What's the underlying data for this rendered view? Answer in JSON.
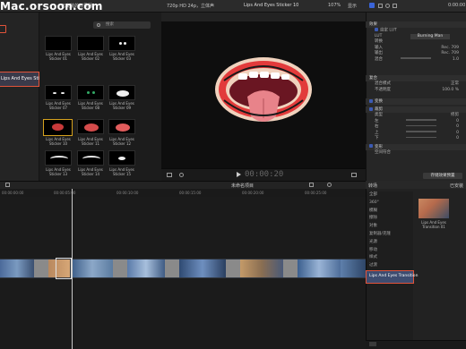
{
  "watermark": "Mac.orsoon.com",
  "topbar": {
    "library_title": "已安装的效果器",
    "format_label": "720p HD 24p，立体声",
    "clip_title": "Lips And Eyes Sticker 10",
    "zoom": "107%",
    "view": "显示"
  },
  "search": {
    "placeholder": "搜索"
  },
  "sidebar": {
    "items": [
      "",
      "",
      "",
      "",
      "",
      "",
      "",
      "",
      "",
      "",
      "Lips And Eyes Stickers"
    ]
  },
  "thumbnails": [
    {
      "label": "Lips And Eyes Sticker 01"
    },
    {
      "label": "Lips And Eyes Sticker 02"
    },
    {
      "label": "Lips And Eyes Sticker 03"
    },
    {
      "label": "Lips And Eyes Sticker 07"
    },
    {
      "label": "Lips And Eyes Sticker 08"
    },
    {
      "label": "Lips And Eyes Sticker 09"
    },
    {
      "label": "Lips And Eyes Sticker 10"
    },
    {
      "label": "Lips And Eyes Sticker 11"
    },
    {
      "label": "Lips And Eyes Sticker 12"
    },
    {
      "label": "Lips And Eyes Sticker 13"
    },
    {
      "label": "Lips And Eyes Sticker 14"
    },
    {
      "label": "Lips And Eyes Sticker 15"
    }
  ],
  "viewer": {
    "timecode": "00:00:20"
  },
  "inspector": {
    "time": "0:00:00",
    "effects_label": "效果",
    "custom_lut": "自定 LUT",
    "lut_label": "LUT",
    "lut_value": "Burning Man",
    "conversion": "转换",
    "input": "输入",
    "input_value": "Rec. 709",
    "output": "输出",
    "output_value": "Rec. 709",
    "mix": "混合",
    "mix_value": "1.0",
    "composite": "复合",
    "blend_mode": "混合模式",
    "blend_value": "正常",
    "opacity": "不透明度",
    "opacity_value": "100.0 %",
    "transform": "变换",
    "crop": "裁剪",
    "crop_type": "类型",
    "crop_type_value": "修剪",
    "left": "左",
    "right": "右",
    "top": "上",
    "bottom": "下",
    "crop_left_value": "0",
    "crop_right_value": "0",
    "crop_top_value": "0",
    "crop_bottom_value": "0",
    "distort": "变形",
    "stabilization": "空间符合",
    "save_effects": "存储效果预置"
  },
  "timeline": {
    "project_name": "未命名项目",
    "ruler_marks": [
      "00:00:00:00",
      "00:00:05:00",
      "00:00:10:00",
      "00:00:15:00",
      "00:00:20:00",
      "00:00:25:00"
    ]
  },
  "transitions": {
    "header": "转场",
    "installed": "已安装",
    "categories": [
      "全部",
      "360°",
      "模糊",
      "擦除",
      "对象",
      "复制器/克隆",
      "光源",
      "移动",
      "样式",
      "过渡",
      "擦除",
      "叠化",
      "Lips And Eyes Transition"
    ],
    "selected_index": 12,
    "thumb_label": "Lips And Eyes Transition 01"
  }
}
